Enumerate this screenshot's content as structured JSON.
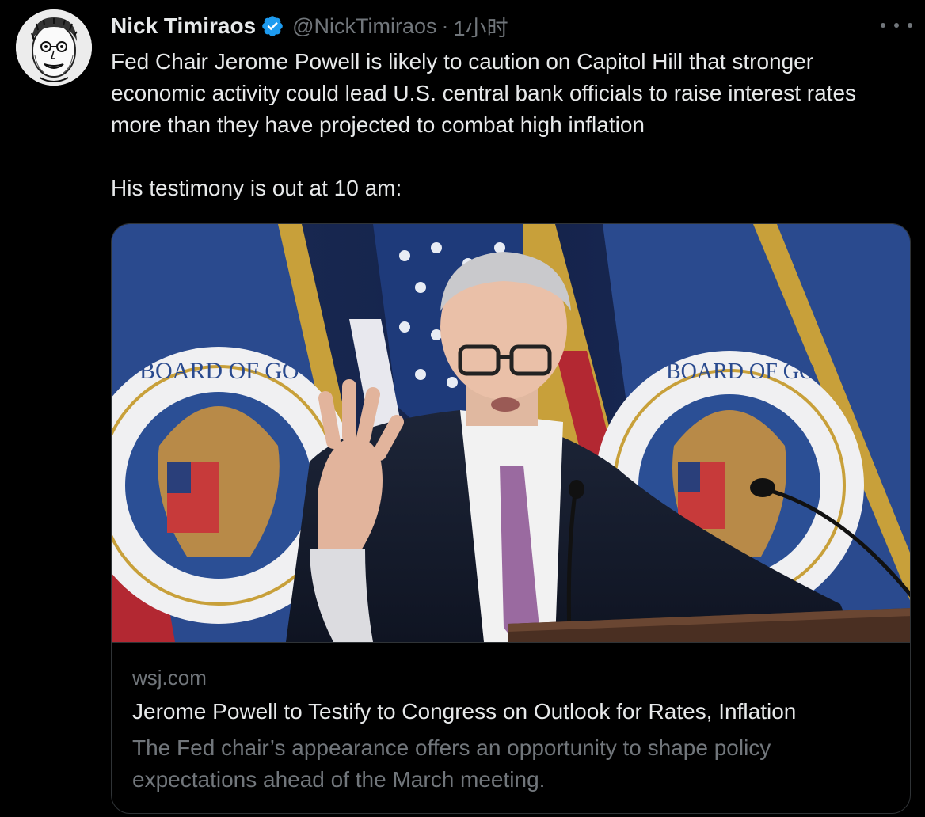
{
  "author": {
    "name": "Nick Timiraos",
    "handle": "@NickTimiraos",
    "separator": "·",
    "time": "1小时",
    "verified_icon": "verified-badge-icon",
    "verified_color": "#1d9bf0"
  },
  "more_icon": "more-options-icon",
  "tweet": {
    "line1": "Fed Chair Jerome Powell is likely to caution on Capitol Hill that stronger economic activity could lead U.S. central bank officials to raise interest rates more than they have projected to combat high inflation",
    "line2": "His testimony is out at 10 am:"
  },
  "card": {
    "domain": "wsj.com",
    "title": "Jerome Powell to Testify to Congress on Outlook for Rates, Inflation",
    "description": "The Fed chair’s appearance offers an opportunity to shape policy expectations ahead of the March meeting."
  },
  "image_text": {
    "seal_left": "BOARD OF GO",
    "seal_right": "BOARD OF GO"
  },
  "colors": {
    "background": "#000000",
    "text_primary": "#e7e9ea",
    "text_secondary": "#71767b",
    "border": "#2f3336"
  }
}
